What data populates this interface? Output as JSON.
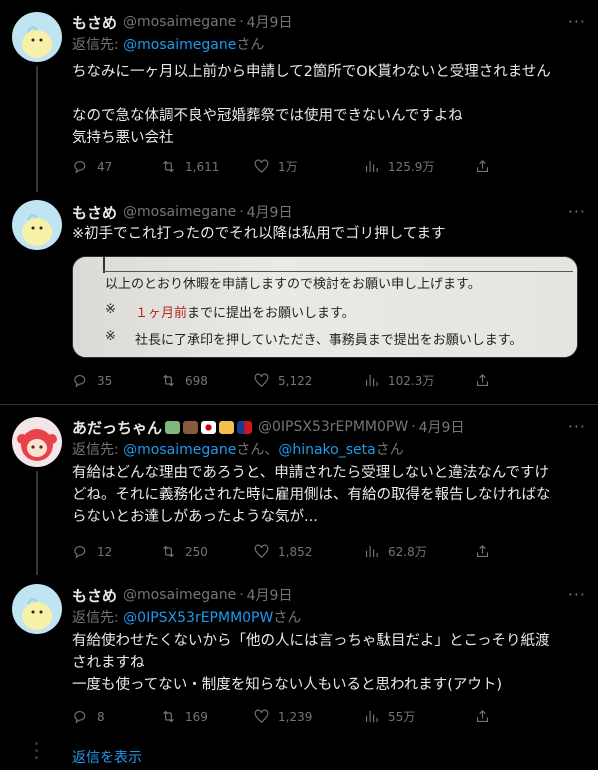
{
  "tweets": [
    {
      "name": "もさめ",
      "handle": "@mosaimegane",
      "dot": "·",
      "date": "4月9日",
      "reply_prefix": "返信先: ",
      "reply_mentions": "@mosaimegane",
      "reply_suffix": "さん",
      "lines": [
        "ちなみに一ヶ月以上前から申請して2箇所でOK貰わないと受理されません",
        "",
        "なので急な体調不良や冠婚葬祭では使用できないんですよね",
        "気持ち悪い会社"
      ],
      "stats": {
        "replies": "47",
        "retweets": "1,611",
        "likes": "1万",
        "views": "125.9万"
      }
    },
    {
      "name": "もさめ",
      "handle": "@mosaimegane",
      "dot": "·",
      "date": "4月9日",
      "lines": [
        "※初手でこれ打ったのでそれ以降は私用でゴリ押してます"
      ],
      "media": {
        "line1": "以上のとおり休暇を申請しますので検討をお願い申し上げます。",
        "mark": "※",
        "line2_red": "１ヶ月前",
        "line2_rest": "までに提出をお願いします。",
        "line3": "社長に了承印を押していただき、事務員まで提出をお願いします。"
      },
      "stats": {
        "replies": "35",
        "retweets": "698",
        "likes": "5,122",
        "views": "102.3万"
      }
    },
    {
      "name": "あだっちゃん",
      "handle": "@0IPSX53rEPMM0PW",
      "dot": "·",
      "date": "4月9日",
      "reply_prefix": "返信先: ",
      "reply_mention1": "@mosaimegane",
      "reply_mid": "さん、",
      "reply_mention2": "@hinako_seta",
      "reply_suffix": "さん",
      "lines": [
        "有給はどんな理由であろうと、申請されたら受理しないと違法なんですけ",
        "どね。それに義務化された時に雇用側は、有給の取得を報告しなければな",
        "らないとお達しがあったような気が..."
      ],
      "stats": {
        "replies": "12",
        "retweets": "250",
        "likes": "1,852",
        "views": "62.8万"
      }
    },
    {
      "name": "もさめ",
      "handle": "@mosaimegane",
      "dot": "·",
      "date": "4月9日",
      "reply_prefix": "返信先: ",
      "reply_mentions": "@0IPSX53rEPMM0PW",
      "reply_suffix": "さん",
      "lines": [
        "有給使わせたくないから「他の人には言っちゃ駄目だよ」とこっそり紙渡",
        "されますね",
        "一度も使ってない・制度を知らない人もいると思われます(アウト)"
      ],
      "stats": {
        "replies": "8",
        "retweets": "169",
        "likes": "1,239",
        "views": "55万"
      }
    }
  ],
  "more_label": "···",
  "show_replies": "返信を表示",
  "colors": {
    "accent": "#1d9bf0",
    "muted": "#71767b",
    "background": "#000000",
    "text": "#e7e9ea"
  },
  "icons": [
    "reply-icon",
    "retweet-icon",
    "like-icon",
    "views-icon",
    "share-icon",
    "more-icon"
  ]
}
